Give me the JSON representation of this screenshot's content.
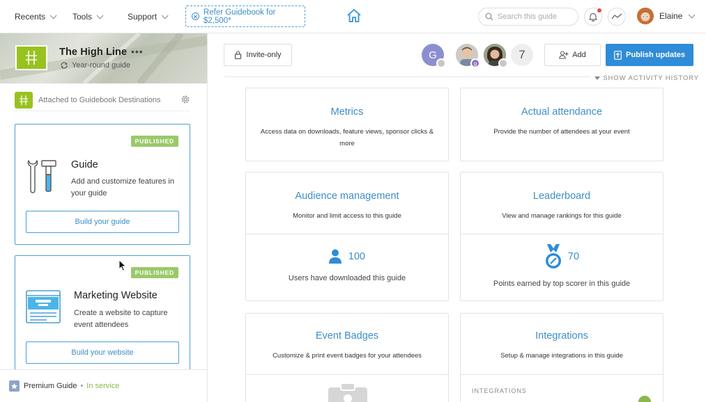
{
  "nav": {
    "recents": "Recents",
    "tools": "Tools",
    "support": "Support",
    "refer": "Refer Guidebook for $2,500*",
    "search_placeholder": "Search this guide",
    "user_name": "Elaine"
  },
  "guide": {
    "title": "The High Line",
    "subtitle": "Year-round guide",
    "attached": "Attached to Guidebook Destinations"
  },
  "cards": [
    {
      "badge": "PUBLISHED",
      "title": "Guide",
      "desc": "Add and customize features in your guide",
      "button": "Build your guide"
    },
    {
      "badge": "PUBLISHED",
      "title": "Marketing Website",
      "desc": "Create a website to capture event attendees",
      "button": "Build your website"
    }
  ],
  "footer": {
    "plan": "Premium Guide",
    "status": "In service"
  },
  "toolbar": {
    "invite": "Invite-only",
    "avatar_initial": "G",
    "avatar_badge": "g",
    "collaborator_count": "7",
    "add": "Add",
    "publish": "Publish updates",
    "activity": "SHOW ACTIVITY HISTORY"
  },
  "panels": {
    "metrics": {
      "title": "Metrics",
      "desc": "Access data on downloads, feature views, sponsor clicks & more"
    },
    "attendance": {
      "title": "Actual attendance",
      "desc": "Provide the number of attendees at your event"
    },
    "audience": {
      "title": "Audience management",
      "desc": "Monitor and limit access to this guide",
      "stat": "100",
      "stat_desc": "Users have downloaded this guide"
    },
    "leaderboard": {
      "title": "Leaderboard",
      "desc": "View and manage rankings for this guide",
      "stat": "70",
      "stat_desc": "Points earned by top scorer in this guide"
    },
    "badges": {
      "title": "Event Badges",
      "desc": "Customize & print event badges for your attendees"
    },
    "integrations": {
      "title": "Integrations",
      "desc": "Setup & manage integrations in this guide",
      "label": "INTEGRATIONS"
    }
  },
  "colors": {
    "accent": "#3d8ec9",
    "primary_button": "#2f8cd8",
    "brand_green": "#98c21f",
    "published": "#9bc96a"
  }
}
